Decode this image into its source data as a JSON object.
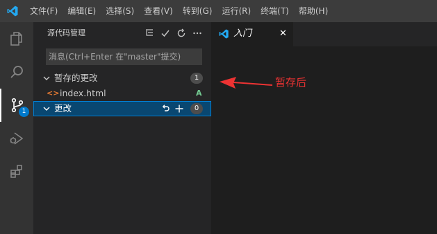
{
  "menu": [
    "文件(F)",
    "编辑(E)",
    "选择(S)",
    "查看(V)",
    "转到(G)",
    "运行(R)",
    "终端(T)",
    "帮助(H)"
  ],
  "activity": {
    "scm_badge": "1"
  },
  "sidebar": {
    "title": "源代码管理",
    "commit_placeholder": "消息(Ctrl+Enter 在\"master\"提交)",
    "staged": {
      "label": "暂存的更改",
      "count": "1",
      "files": [
        {
          "icon": "<>",
          "name": "index.html",
          "status": "A"
        }
      ]
    },
    "changes": {
      "label": "更改",
      "count": "0"
    }
  },
  "editor": {
    "tab_label": "入门",
    "tab_close": "✕"
  },
  "annotation": {
    "text": "暂存后",
    "color": "#ee3333"
  },
  "colors": {
    "accent": "#007acc",
    "selection": "#094771",
    "added": "#73c991"
  }
}
